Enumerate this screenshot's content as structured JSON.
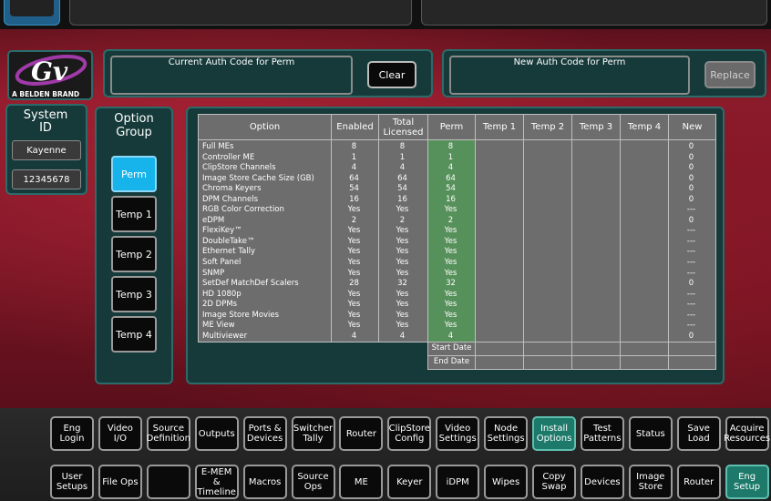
{
  "branding": {
    "tagline": "A BELDEN BRAND",
    "logo_icon": "grass-valley-logo"
  },
  "system_id": {
    "title": "System ID",
    "name": "Kayenne",
    "number": "12345678"
  },
  "auth": {
    "current_label": "Current Auth Code for Perm",
    "current_value": "",
    "clear_label": "Clear",
    "new_label": "New Auth Code for Perm",
    "new_value": "",
    "replace_label": "Replace"
  },
  "option_group": {
    "title": "Option Group",
    "items": [
      "Perm",
      "Temp 1",
      "Temp 2",
      "Temp 3",
      "Temp 4"
    ],
    "selected": "Perm"
  },
  "table": {
    "headers": [
      "Option",
      "Enabled",
      "Total Licensed",
      "Perm",
      "Temp 1",
      "Temp 2",
      "Temp 3",
      "Temp 4",
      "New"
    ],
    "rows": [
      {
        "option": "Full MEs",
        "enabled": "8",
        "total": "8",
        "perm": "8",
        "new": "0"
      },
      {
        "option": "Controller ME",
        "enabled": "1",
        "total": "1",
        "perm": "1",
        "new": "0"
      },
      {
        "option": "ClipStore Channels",
        "enabled": "4",
        "total": "4",
        "perm": "4",
        "new": "0"
      },
      {
        "option": "Image Store Cache Size (GB)",
        "enabled": "64",
        "total": "64",
        "perm": "64",
        "new": "0"
      },
      {
        "option": "Chroma Keyers",
        "enabled": "54",
        "total": "54",
        "perm": "54",
        "new": "0"
      },
      {
        "option": "DPM Channels",
        "enabled": "16",
        "total": "16",
        "perm": "16",
        "new": "0"
      },
      {
        "option": "RGB Color Correction",
        "enabled": "Yes",
        "total": "Yes",
        "perm": "Yes",
        "new": "---"
      },
      {
        "option": "eDPM",
        "enabled": "2",
        "total": "2",
        "perm": "2",
        "new": "0"
      },
      {
        "option": "FlexiKey™",
        "enabled": "Yes",
        "total": "Yes",
        "perm": "Yes",
        "new": "---"
      },
      {
        "option": "DoubleTake™",
        "enabled": "Yes",
        "total": "Yes",
        "perm": "Yes",
        "new": "---"
      },
      {
        "option": "Ethernet Tally",
        "enabled": "Yes",
        "total": "Yes",
        "perm": "Yes",
        "new": "---"
      },
      {
        "option": "Soft Panel",
        "enabled": "Yes",
        "total": "Yes",
        "perm": "Yes",
        "new": "---"
      },
      {
        "option": "SNMP",
        "enabled": "Yes",
        "total": "Yes",
        "perm": "Yes",
        "new": "---"
      },
      {
        "option": "SetDef MatchDef Scalers",
        "enabled": "28",
        "total": "32",
        "perm": "32",
        "new": "0"
      },
      {
        "option": "HD 1080p",
        "enabled": "Yes",
        "total": "Yes",
        "perm": "Yes",
        "new": "---"
      },
      {
        "option": "2D DPMs",
        "enabled": "Yes",
        "total": "Yes",
        "perm": "Yes",
        "new": "---"
      },
      {
        "option": "Image Store Movies",
        "enabled": "Yes",
        "total": "Yes",
        "perm": "Yes",
        "new": "---"
      },
      {
        "option": "ME View",
        "enabled": "Yes",
        "total": "Yes",
        "perm": "Yes",
        "new": "---"
      },
      {
        "option": "Multiviewer",
        "enabled": "4",
        "total": "4",
        "perm": "4",
        "new": "0"
      }
    ],
    "start_date_label": "Start Date",
    "end_date_label": "End Date"
  },
  "nav_top": [
    "Eng Login",
    "Video I/O",
    "Source Definition",
    "Outputs",
    "Ports & Devices",
    "Switcher Tally",
    "Router",
    "ClipStore Config",
    "Video Settings",
    "Node Settings",
    "Install Options",
    "Test Patterns",
    "Status",
    "Save Load",
    "Acquire Resources"
  ],
  "nav_bottom": [
    "User Setups",
    "File Ops",
    "",
    "E-MEM & Timeline",
    "Macros",
    "Source Ops",
    "ME",
    "Keyer",
    "iDPM",
    "Wipes",
    "Copy Swap",
    "Devices",
    "Image Store",
    "Router",
    "Eng Setup"
  ],
  "nav_active_top": "Install Options",
  "nav_active_bottom": "Eng Setup"
}
